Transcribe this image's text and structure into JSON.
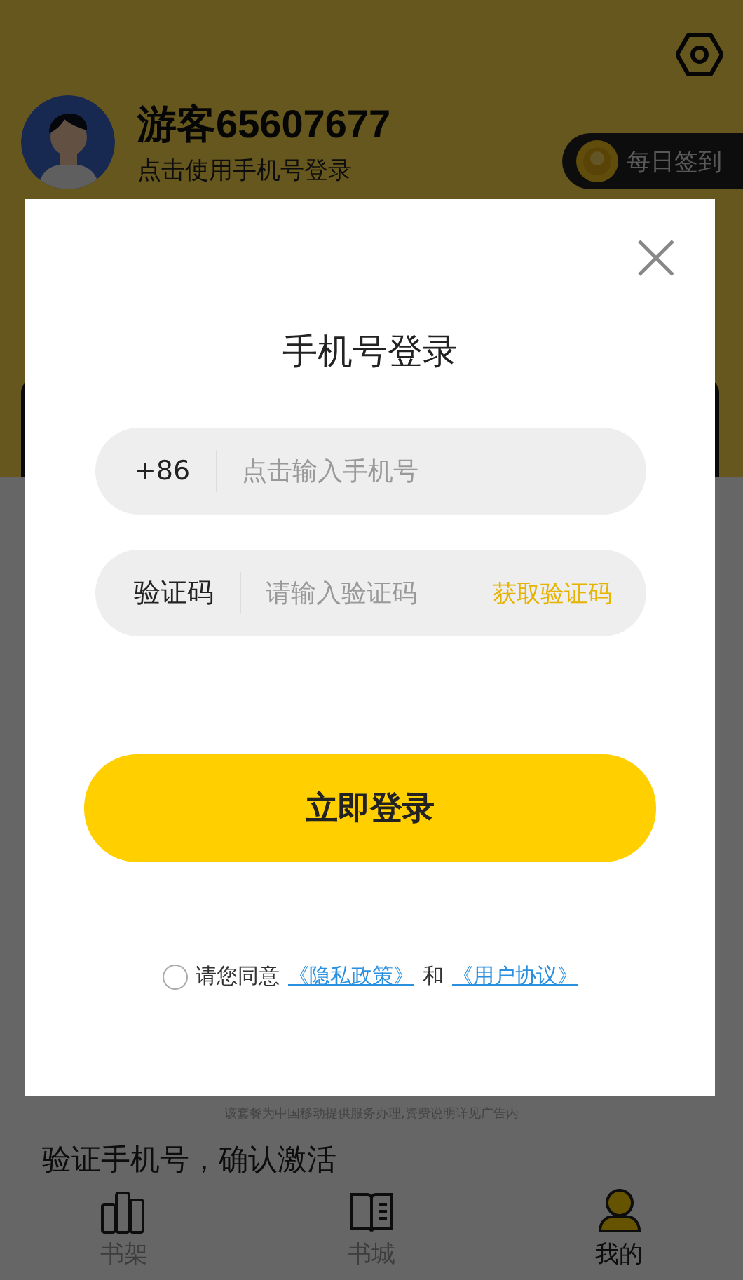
{
  "profile": {
    "name": "游客65607677",
    "subtitle": "点击使用手机号登录",
    "sign_in": "每日签到"
  },
  "notice": "该套餐为中国移动提供服务办理,资费说明详见广告内",
  "activate_text": "验证手机号，确认激活",
  "tabs": [
    {
      "label": "书架",
      "kind": "shelf",
      "selected": false
    },
    {
      "label": "书城",
      "kind": "store",
      "selected": false
    },
    {
      "label": "我的",
      "kind": "profile",
      "selected": true
    }
  ],
  "login_dialog": {
    "title": "手机号登录",
    "phone_field": {
      "prefix": "+86",
      "placeholder": "点击输入手机号"
    },
    "code_field": {
      "label": "验证码",
      "placeholder": "请输入验证码",
      "action": "获取验证码"
    },
    "login_button": "立即登录",
    "agreement": {
      "checked": false,
      "text": "请您同意",
      "privacy_link": "《隐私政策》",
      "conjunction": "和",
      "terms_link": "《用户协议》"
    }
  }
}
